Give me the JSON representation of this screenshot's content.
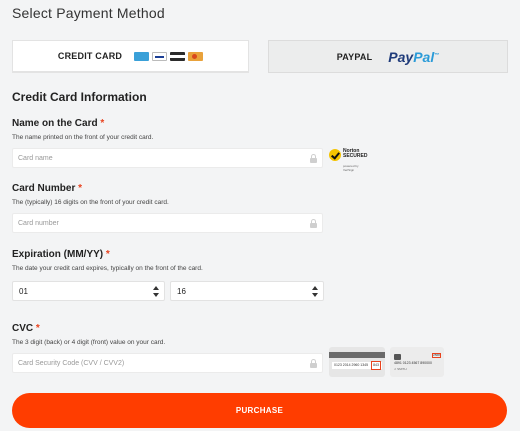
{
  "page_title": "Select Payment Method",
  "methods": {
    "credit_card": {
      "label": "CREDIT CARD",
      "icons": [
        "maestro-card-icon",
        "visa-card-icon",
        "amex-card-icon",
        "mastercard-icon"
      ]
    },
    "paypal": {
      "label": "PAYPAL",
      "logo_a": "Pay",
      "logo_b": "Pal",
      "logo_tm": "™"
    }
  },
  "section_title": "Credit Card Information",
  "required_mark": "*",
  "fields": {
    "name": {
      "label": "Name on the Card",
      "help": "The name printed on the front of your credit card.",
      "placeholder": "Card name"
    },
    "number": {
      "label": "Card Number",
      "help": "The (typically) 16 digits on the front of your credit card.",
      "placeholder": "Card number"
    },
    "expiration": {
      "label": "Expiration (MM/YY)",
      "help": "The date your credit card expires, typically on the front of the card.",
      "month_value": "01",
      "year_value": "16"
    },
    "cvc": {
      "label": "CVC",
      "help": "The 3 digit (back) or 4 digit (front) value on your card.",
      "placeholder": "Card Security Code (CVV / CVV2)"
    }
  },
  "norton": {
    "title": "Norton",
    "subtitle": "SECURED",
    "powered": "powered by VeriSign"
  },
  "cvc_card_back": {
    "number": "0123 2014 2960 1345",
    "code": "843"
  },
  "cvc_card_front": {
    "code": "2568",
    "number": "4891 0123 4567 890000",
    "name": "J. SMITH"
  },
  "purchase_button": "PURCHASE",
  "colors": {
    "accent": "#ff3d00",
    "required": "#e8431f",
    "background": "#f3f4f5"
  }
}
